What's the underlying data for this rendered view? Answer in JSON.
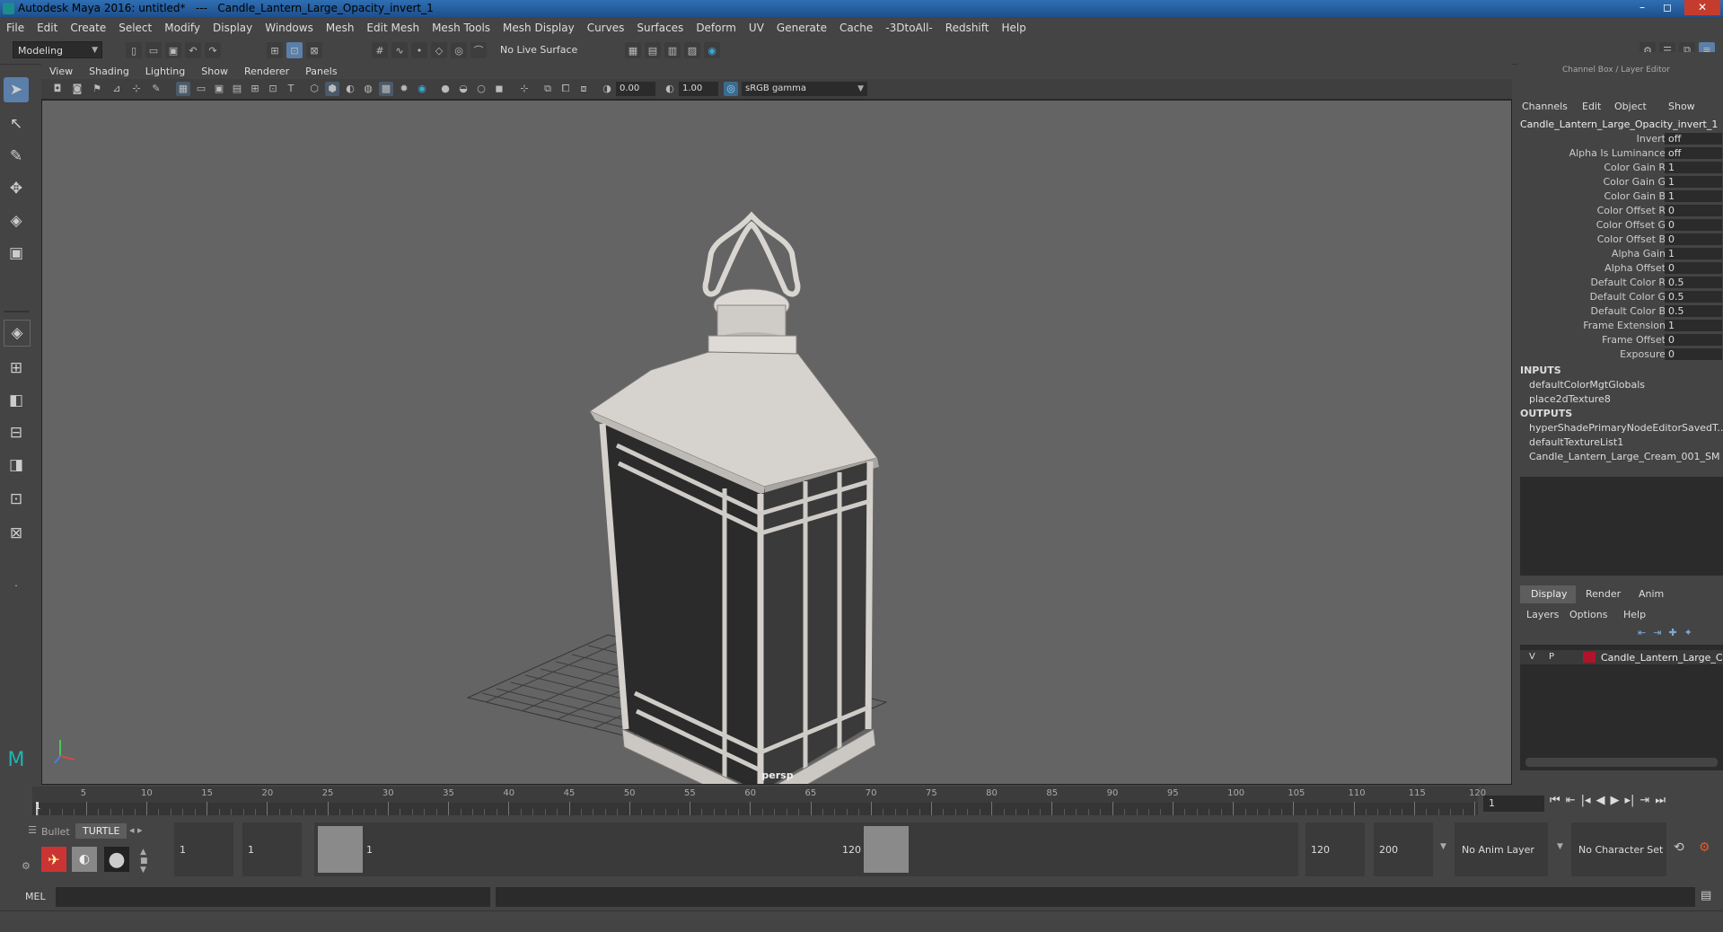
{
  "window": {
    "title": "Autodesk Maya 2016: untitled*   ---   Candle_Lantern_Large_Opacity_invert_1",
    "minimize": "–",
    "maximize": "◻",
    "close": "✕"
  },
  "menubar": [
    "File",
    "Edit",
    "Create",
    "Select",
    "Modify",
    "Display",
    "Windows",
    "Mesh",
    "Edit Mesh",
    "Mesh Tools",
    "Mesh Display",
    "Curves",
    "Surfaces",
    "Deform",
    "UV",
    "Generate",
    "Cache",
    "-3DtoAll-",
    "Redshift",
    "Help"
  ],
  "statusline": {
    "mode": "Modeling",
    "live_surface": "No Live Surface"
  },
  "viewport": {
    "menu": [
      "View",
      "Shading",
      "Lighting",
      "Show",
      "Renderer",
      "Panels"
    ],
    "exposure": "0.00",
    "gamma": "1.00",
    "color_space": "sRGB gamma",
    "camera_label": "persp"
  },
  "channel_box": {
    "header": "Channel Box / Layer Editor",
    "menu": [
      "Channels",
      "Edit",
      "Object",
      "Show"
    ],
    "node_name": "Candle_Lantern_Large_Opacity_invert_1",
    "attributes": [
      {
        "label": "Invert",
        "value": "off"
      },
      {
        "label": "Alpha Is Luminance",
        "value": "off"
      },
      {
        "label": "Color Gain R",
        "value": "1"
      },
      {
        "label": "Color Gain G",
        "value": "1"
      },
      {
        "label": "Color Gain B",
        "value": "1"
      },
      {
        "label": "Color Offset R",
        "value": "0"
      },
      {
        "label": "Color Offset G",
        "value": "0"
      },
      {
        "label": "Color Offset B",
        "value": "0"
      },
      {
        "label": "Alpha Gain",
        "value": "1"
      },
      {
        "label": "Alpha Offset",
        "value": "0"
      },
      {
        "label": "Default Color R",
        "value": "0.5"
      },
      {
        "label": "Default Color G",
        "value": "0.5"
      },
      {
        "label": "Default Color B",
        "value": "0.5"
      },
      {
        "label": "Frame Extension",
        "value": "1"
      },
      {
        "label": "Frame Offset",
        "value": "0"
      },
      {
        "label": "Exposure",
        "value": "0"
      }
    ],
    "inputs_title": "INPUTS",
    "inputs": [
      "defaultColorMgtGlobals",
      "place2dTexture8"
    ],
    "outputs_title": "OUTPUTS",
    "outputs": [
      "hyperShadePrimaryNodeEditorSavedT...",
      "defaultTextureList1",
      "Candle_Lantern_Large_Cream_001_SM"
    ]
  },
  "layer_editor": {
    "tabs": [
      "Display",
      "Render",
      "Anim"
    ],
    "menu": [
      "Layers",
      "Options",
      "Help"
    ],
    "layer": {
      "v": "V",
      "p": "P",
      "name": "Candle_Lantern_Large_C",
      "color": "#b0142a"
    }
  },
  "timeline": {
    "ticks": [
      "5",
      "10",
      "15",
      "20",
      "25",
      "30",
      "35",
      "40",
      "45",
      "50",
      "55",
      "60",
      "65",
      "70",
      "75",
      "80",
      "85",
      "90",
      "95",
      "100",
      "105",
      "110",
      "115",
      "120"
    ],
    "start_marker": "1",
    "current_frame": "1"
  },
  "range": {
    "shelf_tabs": [
      "Bullet",
      "TURTLE"
    ],
    "start": "1",
    "playback_start": "1",
    "range_start_label": "1",
    "range_end_label": "120",
    "playback_end": "120",
    "end": "200",
    "anim_layer": "No Anim Layer",
    "character_set": "No Character Set"
  },
  "cmdline": {
    "label": "MEL"
  }
}
